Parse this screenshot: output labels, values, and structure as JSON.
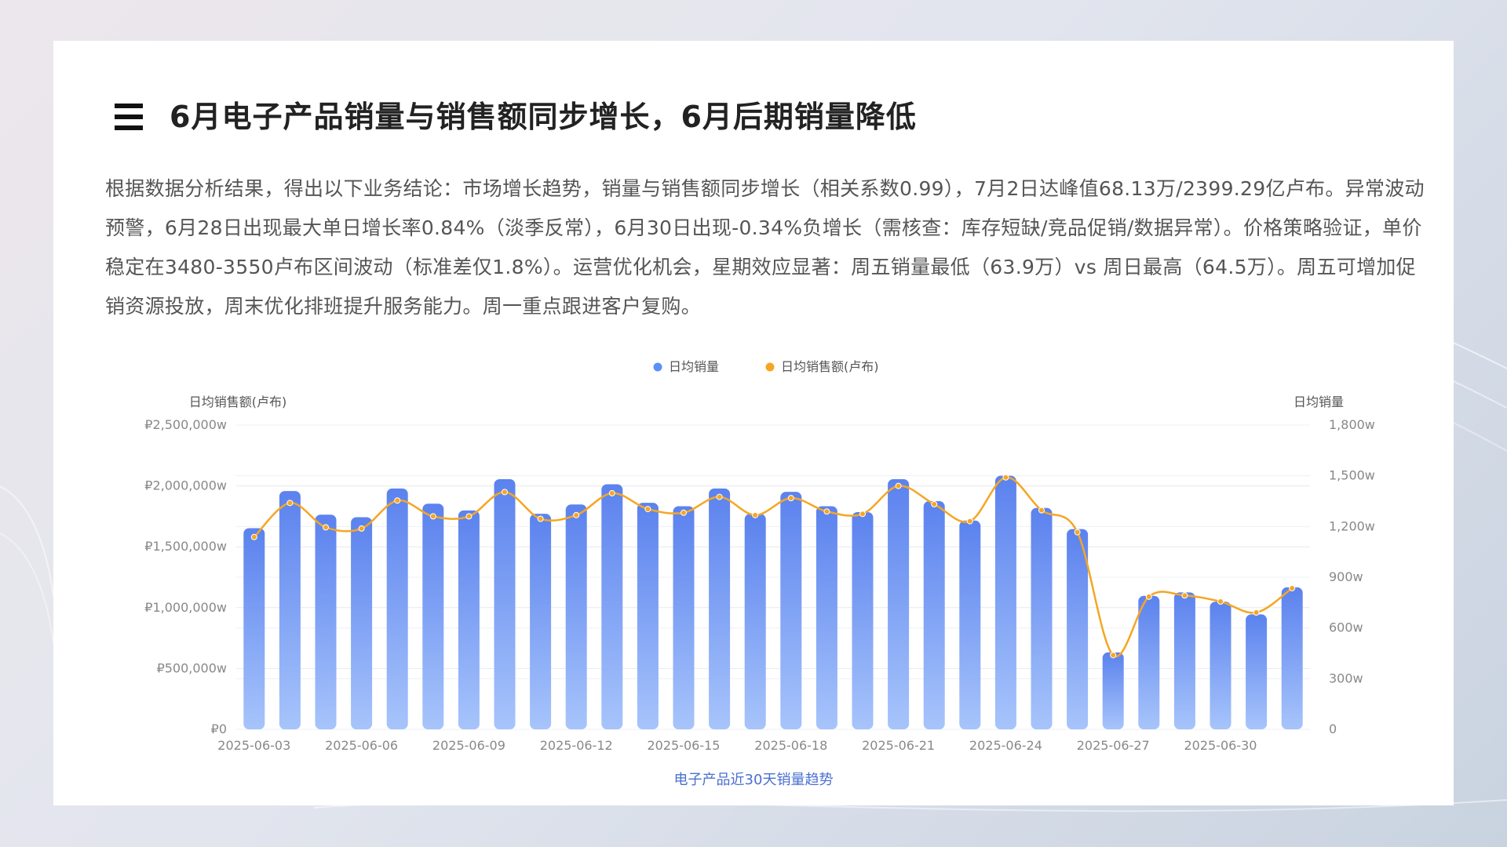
{
  "title": "6月电子产品销量与销售额同步增长，6月后期销量降低",
  "summary": "根据数据分析结果，得出以下业务结论：市场增长趋势，销量与销售额同步增长（相关系数0.99），7月2日达峰值68.13万/2399.29亿卢布。异常波动预警，6月28日出现最大单日增长率0.84%（淡季反常），6月30日出现-0.34%负增长（需核查：库存短缺/竞品促销/数据异常）。价格策略验证，单价稳定在3480-3550卢布区间波动（标准差仅1.8%）。运营优化机会，星期效应显著：周五销量最低（63.9万）vs 周日最高（64.5万）。周五可增加促销资源投放，周末优化排班提升服务能力。周一重点跟进客户复购。",
  "colors": {
    "bar_top": "#5b82ee",
    "bar_bottom": "#a7c4fb",
    "line": "#f5a623",
    "legend_volume": "#5b8ff9"
  },
  "chart_data": {
    "type": "bar+line",
    "title": "电子产品近30天销量趋势",
    "y_left_label": "日均销售额(卢布)",
    "y_right_label": "日均销量",
    "y_left_ticks": [
      "₽0",
      "₽500,000w",
      "₽1,000,000w",
      "₽1,500,000w",
      "₽2,000,000w",
      "₽2,500,000w"
    ],
    "y_right_ticks": [
      "0",
      "300w",
      "600w",
      "900w",
      "1,200w",
      "1,500w",
      "1,800w"
    ],
    "y_left_range": [
      0,
      2500000
    ],
    "y_right_range": [
      0,
      1800
    ],
    "x_tick_labels": [
      "2025-06-03",
      "2025-06-06",
      "2025-06-09",
      "2025-06-12",
      "2025-06-15",
      "2025-06-18",
      "2025-06-21",
      "2025-06-24",
      "2025-06-27",
      "2025-06-30"
    ],
    "x_tick_start_index": 0,
    "x_tick_step": 3,
    "categories": [
      "2025-06-03",
      "2025-06-04",
      "2025-06-05",
      "2025-06-06",
      "2025-06-07",
      "2025-06-08",
      "2025-06-09",
      "2025-06-10",
      "2025-06-11",
      "2025-06-12",
      "2025-06-13",
      "2025-06-14",
      "2025-06-15",
      "2025-06-16",
      "2025-06-17",
      "2025-06-18",
      "2025-06-19",
      "2025-06-20",
      "2025-06-21",
      "2025-06-22",
      "2025-06-23",
      "2025-06-24",
      "2025-06-25",
      "2025-06-26",
      "2025-06-27",
      "2025-06-28",
      "2025-06-29",
      "2025-06-30",
      "2025-07-01"
    ],
    "legend_position": "top-center",
    "series": [
      {
        "name": "日均销量",
        "type": "bar",
        "axis": "right",
        "values": [
          1190,
          1410,
          1270,
          1255,
          1425,
          1335,
          1295,
          1480,
          1275,
          1330,
          1450,
          1340,
          1320,
          1425,
          1275,
          1405,
          1320,
          1285,
          1480,
          1350,
          1235,
          1500,
          1310,
          1185,
          455,
          790,
          810,
          755,
          680,
          840
        ]
      },
      {
        "name": "日均销售额(卢布)",
        "type": "line",
        "axis": "left",
        "values": [
          1580000,
          1860000,
          1660000,
          1650000,
          1880000,
          1750000,
          1750000,
          1950000,
          1730000,
          1760000,
          1940000,
          1810000,
          1780000,
          1910000,
          1760000,
          1900000,
          1790000,
          1770000,
          2000000,
          1850000,
          1710000,
          2070000,
          1800000,
          1620000,
          610000,
          1090000,
          1100000,
          1050000,
          960000,
          1160000
        ]
      }
    ]
  }
}
